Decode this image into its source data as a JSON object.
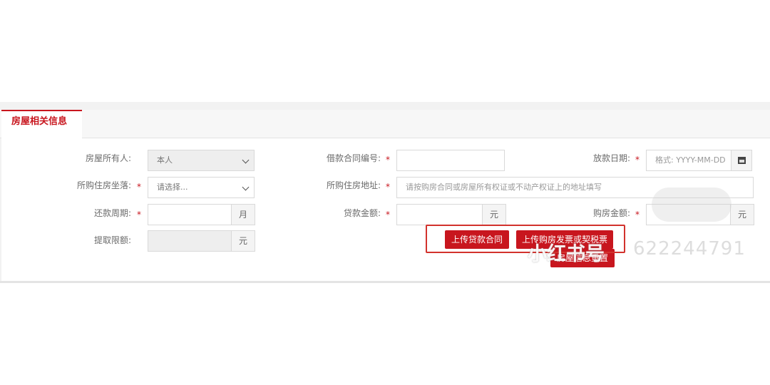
{
  "tab": {
    "label": "房屋相关信息"
  },
  "form": {
    "owner_label": "房屋所有人:",
    "owner_value": "本人",
    "location_label": "所购住房坐落:",
    "location_placeholder": "请选择...",
    "period_label": "还款周期:",
    "period_unit": "月",
    "limit_label": "提取限额:",
    "limit_unit": "元",
    "contract_no_label": "借款合同编号:",
    "address_label": "所购住房地址:",
    "address_placeholder": "请按购房合同或房屋所有权证或不动产权证上的地址填写",
    "loan_amount_label": "贷款金额:",
    "loan_amount_unit": "元",
    "loan_date_label": "放款日期:",
    "loan_date_placeholder": "格式: YYYY-MM-DD",
    "purchase_amount_label": "购房金额:",
    "purchase_amount_unit": "元",
    "required_mark": "*"
  },
  "buttons": {
    "upload_loan_contract": "上传贷款合同",
    "upload_purchase": "上传购房发票或契税票",
    "reset_house_info": "房屋信息重置"
  },
  "watermark": {
    "text": "小红书号",
    "number": "622244791"
  },
  "colors": {
    "accent": "#c8161e",
    "highlight_box": "#d2322d"
  },
  "icons": {
    "calendar": "calendar-icon",
    "chevron": "chevron-down-icon"
  }
}
